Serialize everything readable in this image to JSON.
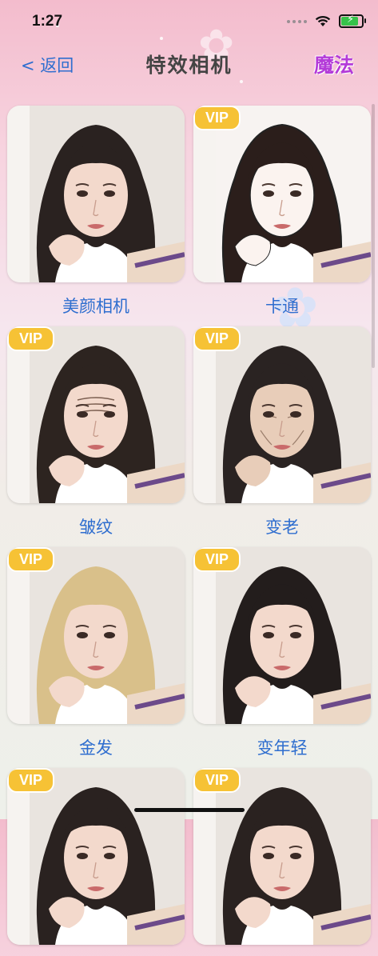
{
  "status": {
    "time": "1:27"
  },
  "nav": {
    "back_label": "< 返回",
    "title": "特效相机",
    "right_label": "魔法"
  },
  "effects": [
    {
      "label": "美颜相机",
      "vip": "",
      "style": "normal",
      "hair": "#2a2220"
    },
    {
      "label": "卡通",
      "vip": "VIP",
      "style": "cartoon",
      "hair": "#2b1e1b"
    },
    {
      "label": "皱纹",
      "vip": "VIP",
      "style": "wrinkle",
      "hair": "#2d2420"
    },
    {
      "label": "变老",
      "vip": "VIP",
      "style": "old",
      "hair": "#2a2322"
    },
    {
      "label": "金发",
      "vip": "VIP",
      "style": "blonde",
      "hair": "#d9c08a"
    },
    {
      "label": "变年轻",
      "vip": "VIP",
      "style": "young",
      "hair": "#231d1c"
    },
    {
      "label": "",
      "vip": "VIP",
      "style": "normal",
      "hair": "#2a2220"
    },
    {
      "label": "",
      "vip": "VIP",
      "style": "normal",
      "hair": "#2a2220"
    }
  ]
}
